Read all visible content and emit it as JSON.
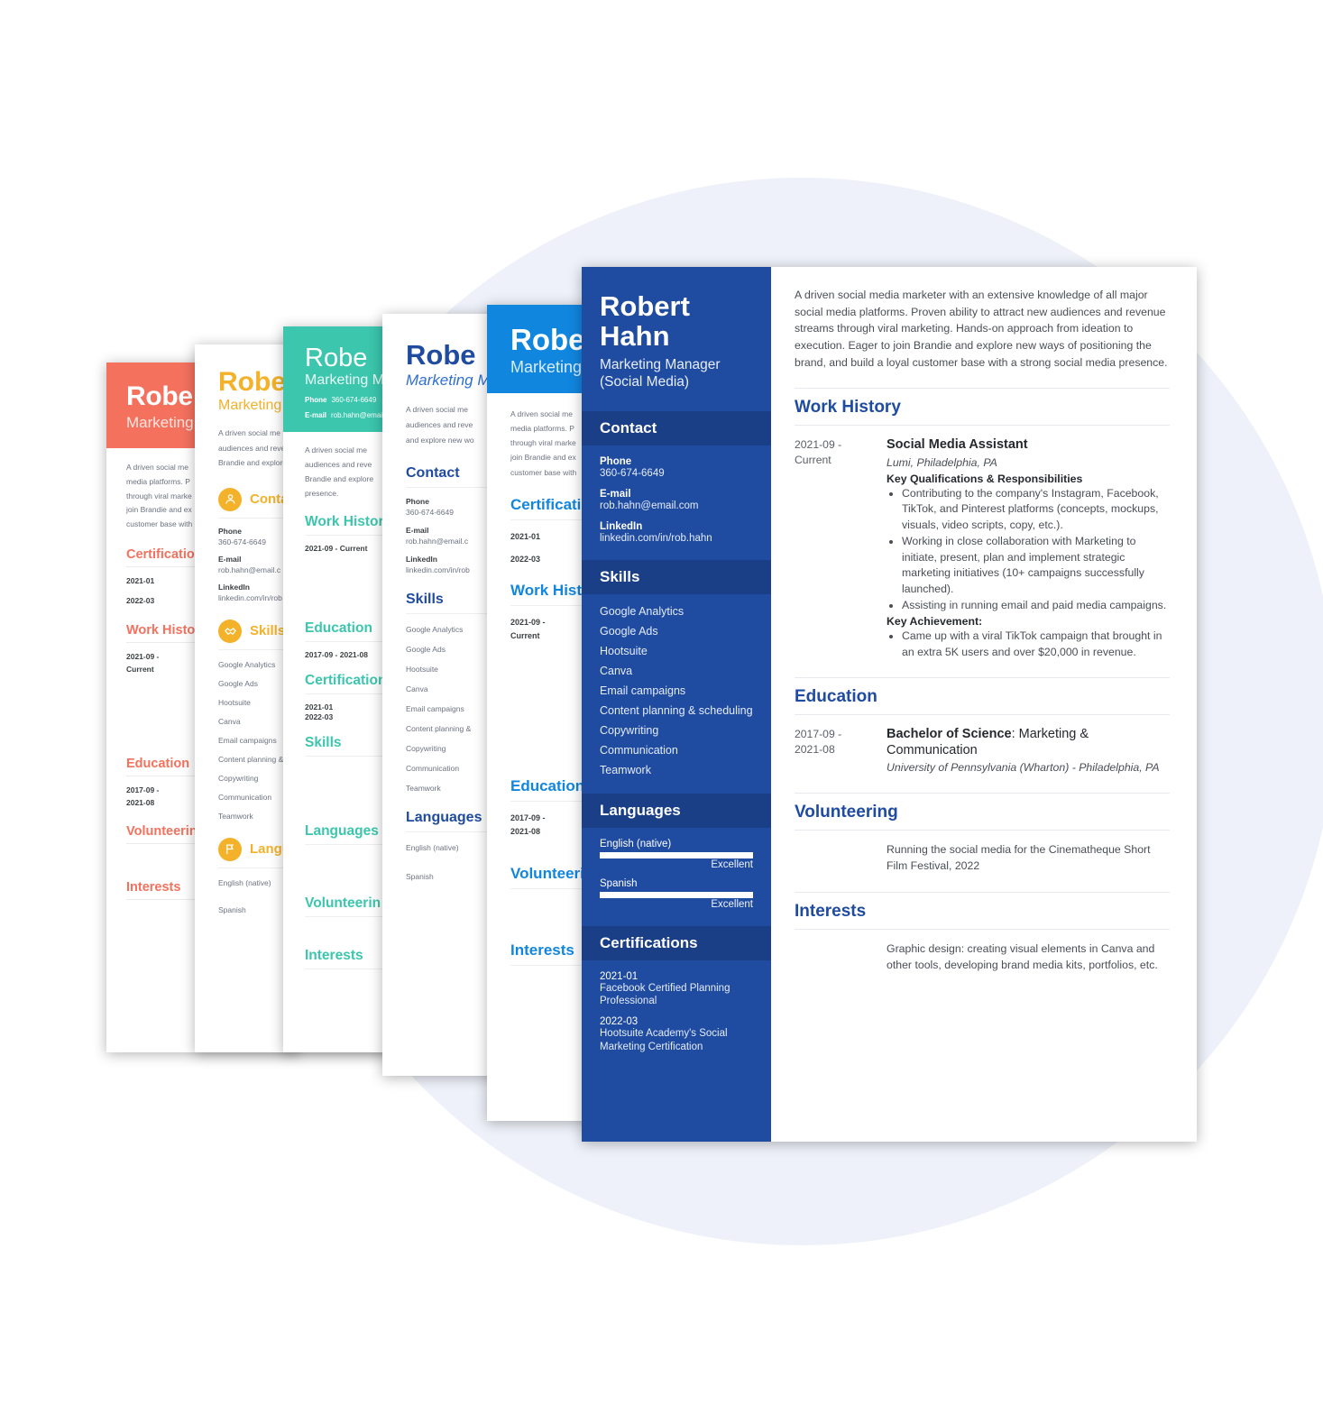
{
  "person": {
    "first_name": "Robert",
    "last_name": "Hahn",
    "full_name": "Robert Hahn",
    "short_name": "Robe",
    "role_line1": "Marketing Manager",
    "role_line2": "(Social Media)",
    "role_full": "Marketing Manager (Social Media)",
    "role_short": "Marketing M",
    "role_trunc": "Marketing"
  },
  "summary": "A driven social media marketer with an extensive knowledge of all major social media platforms. Proven ability to attract new audiences and revenue streams through viral marketing. Hands-on approach from ideation to execution. Eager to join Brandie and explore new ways of positioning the brand, and build a loyal customer base with a strong social media presence.",
  "summary_clips": {
    "a1": "A driven social me",
    "a2": "media platforms. P",
    "a3": "through viral marke",
    "a4": "join Brandie and ex",
    "a5": "customer base with",
    "b1": "A driven social me",
    "b2": "audiences and reve",
    "b3": "Brandie and explore",
    "b4": "presence.",
    "c1": "A driven social me",
    "c2": "audiences and reve",
    "c3": "and explore new wo"
  },
  "contact": {
    "heading": "Contact",
    "phone_label": "Phone",
    "phone_value": "360-674-6649",
    "email_label": "E-mail",
    "email_value": "rob.hahn@email.com",
    "email_clip": "rob.hahn@email.c",
    "linkedin_label": "LinkedIn",
    "linkedin_value": "linkedin.com/in/rob.hahn",
    "linkedin_clip": "linkedin.com/in/rob"
  },
  "sections": {
    "work_history": "Work History",
    "education": "Education",
    "volunteering": "Volunteering",
    "interests": "Interests",
    "skills": "Skills",
    "languages": "Languages",
    "certifications": "Certifications"
  },
  "skills": [
    "Google Analytics",
    "Google Ads",
    "Hootsuite",
    "Canva",
    "Email campaigns",
    "Content planning & scheduling",
    "Copywriting",
    "Communication",
    "Teamwork"
  ],
  "skills_clipped": "Content planning &",
  "languages": [
    {
      "name": "English (native)",
      "level": "Excellent",
      "percent": 100
    },
    {
      "name": "Spanish",
      "level": "Excellent",
      "percent": 100
    }
  ],
  "certifications": [
    {
      "date": "2021-01",
      "name": "Facebook Certified Planning Professional"
    },
    {
      "date": "2022-03",
      "name": "Hootsuite Academy's Social Marketing Certification"
    }
  ],
  "work_history": [
    {
      "date_from": "2021-09 -",
      "date_to": "Current",
      "date_inline": "2021-09 - Current",
      "title": "Social Media Assistant",
      "organization": "Lumi, Philadelphia, PA",
      "qualifications_label": "Key Qualifications & Responsibilities",
      "bullets": [
        "Contributing to the company's Instagram, Facebook, TikTok, and Pinterest platforms (concepts, mockups, visuals, video scripts, copy, etc.).",
        "Working in close collaboration with Marketing to initiate, present, plan and implement strategic marketing initiatives (10+ campaigns successfully launched).",
        "Assisting in running email and paid media campaigns."
      ],
      "achievement_label": "Key Achievement:",
      "achievements": [
        "Came up with a viral TikTok campaign that brought in an extra 5K users and over $20,000 in revenue."
      ]
    }
  ],
  "education": [
    {
      "date_from": "2017-09 -",
      "date_to": "2021-08",
      "date_inline": "2017-09 - 2021-08",
      "degree_bold": "Bachelor of Science",
      "degree_rest": ": Marketing & Communication",
      "school": "University of Pennsylvania (Wharton) - Philadelphia, PA"
    }
  ],
  "volunteering": {
    "text": "Running the social media for the Cinematheque Short Film Festival, 2022"
  },
  "interests": {
    "text": "Graphic design: creating visual elements in Canva and other tools, developing brand media kits, portfolios, etc."
  },
  "colors": {
    "coral": "#F4715E",
    "yellow": "#F3B229",
    "teal": "#3BC6AD",
    "royal": "#1F4BA0",
    "bright_blue": "#1186DE",
    "backdrop": "#EEF1F9"
  },
  "clips": {
    "certifications_trunc": "Certification",
    "work_history_trunc": "Work Histor",
    "volunteering_trunc": "Volunteerin",
    "languages_trunc": "Langu",
    "contact_trunc": "Conta"
  }
}
